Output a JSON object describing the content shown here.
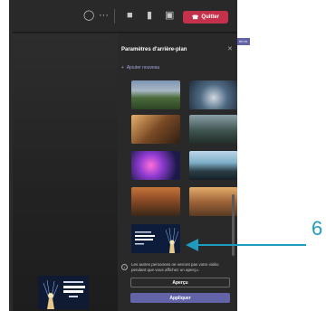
{
  "topbar": {
    "icons": [
      "chat-icon",
      "more-icon",
      "camera-icon",
      "mic-icon",
      "share-icon"
    ],
    "leave_label": "Quitter",
    "leave_icon": "phone-hangup-icon",
    "leave_color": "#c4314b"
  },
  "panel": {
    "title": "Paramètres d'arrière-plan",
    "close_icon": "close-icon",
    "add_new_label": "Ajouter nouveau",
    "info_text": "Les autres personnes ne verront pas votre vidéo pendant que vous affichez un aperçu.",
    "preview_label": "Aperçu",
    "apply_label": "Appliquer",
    "accent": "#6264a7"
  },
  "annotation": {
    "number": "6",
    "color": "#1f9bbf"
  },
  "edge_tag": "en m"
}
